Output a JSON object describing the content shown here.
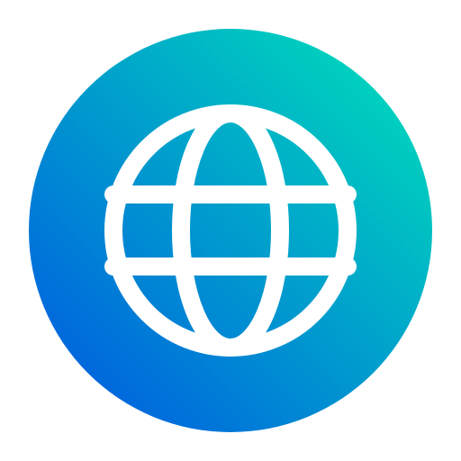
{
  "icon": {
    "name": "globe-icon",
    "background": {
      "shape": "circle",
      "gradient_start": "#0053E3",
      "gradient_end": "#00E5B8"
    },
    "glyph_color": "#FFFFFF"
  }
}
